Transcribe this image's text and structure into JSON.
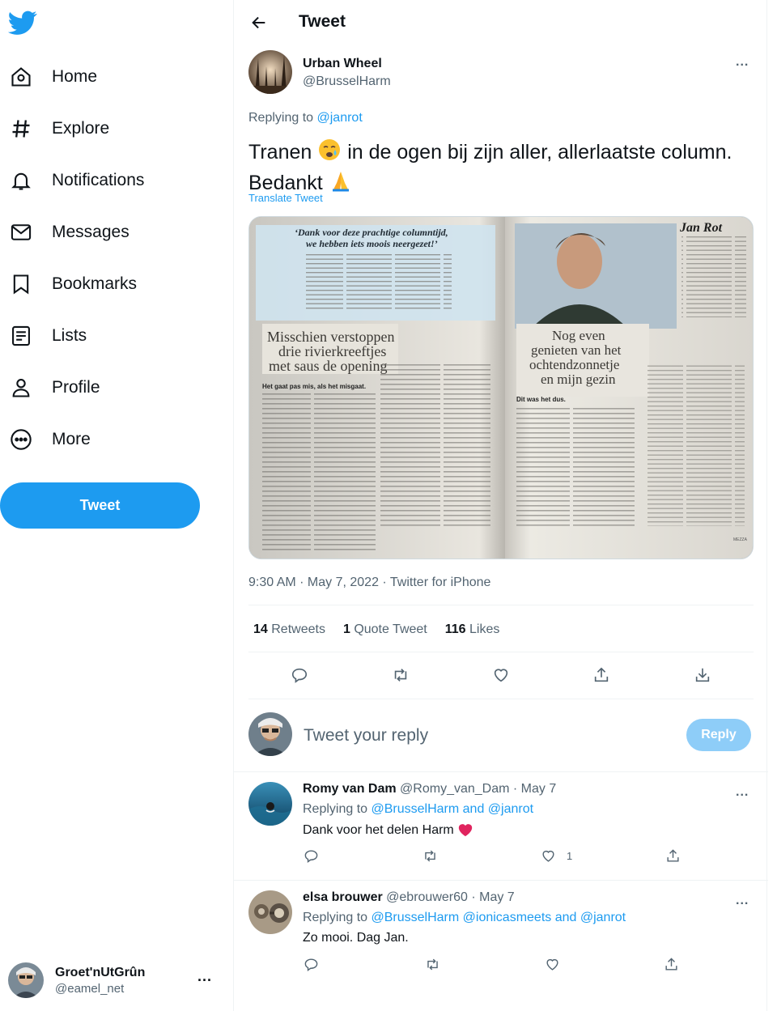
{
  "colors": {
    "brand": "#1d9bf0",
    "reply_disabled": "#8ecdf8",
    "heart": "#f91880",
    "secondary_text": "#536471"
  },
  "sidebar": {
    "logo": "twitter-bird-icon",
    "items": [
      {
        "label": "Home",
        "icon": "home-icon"
      },
      {
        "label": "Explore",
        "icon": "hashtag-icon"
      },
      {
        "label": "Notifications",
        "icon": "bell-icon"
      },
      {
        "label": "Messages",
        "icon": "envelope-icon"
      },
      {
        "label": "Bookmarks",
        "icon": "bookmark-icon"
      },
      {
        "label": "Lists",
        "icon": "list-icon"
      },
      {
        "label": "Profile",
        "icon": "person-icon"
      },
      {
        "label": "More",
        "icon": "more-circle-icon"
      }
    ],
    "tweet_button": "Tweet",
    "account": {
      "name": "Groet'nUtGrûn",
      "handle": "@eamel_net",
      "more": "..."
    }
  },
  "header": {
    "title": "Tweet"
  },
  "tweet": {
    "author_name": "Urban Wheel",
    "author_handle": "@BrusselHarm",
    "more": "...",
    "replying_prefix": "Replying to",
    "replying_to": "@janrot",
    "text_part1": "Tranen",
    "text_part2": "in de ogen bij zijn aller, allerlaatste column. Bedankt",
    "translate": "Translate Tweet",
    "media": {
      "left_quote": "'Dank voor deze prachtige columntijd, we hebben iets moois neergezet!'",
      "left_headline_1": "Misschien verstoppen",
      "left_headline_2": "drie rivierkreeftjes",
      "left_headline_3": "met saus de opening",
      "left_lead": "Het gaat pas mis, als het misgaat.",
      "right_byline": "Jan Rot",
      "right_headline_1": "Nog even",
      "right_headline_2": "genieten van het",
      "right_headline_3": "ochtendzonnetje",
      "right_headline_4": "en mijn gezin",
      "right_lead": "Dit was het dus.",
      "footer": "MEZZA"
    },
    "meta": "9:30 AM · May 7, 2022 · Twitter for iPhone",
    "stats": {
      "retweets_count": "14",
      "retweets_label": "Retweets",
      "quotes_count": "1",
      "quotes_label": "Quote Tweet",
      "likes_count": "116",
      "likes_label": "Likes"
    }
  },
  "reply_box": {
    "placeholder": "Tweet your reply",
    "button": "Reply"
  },
  "replies": [
    {
      "name": "Romy van Dam",
      "handle_date": "@Romy_van_Dam · May 7",
      "replying_prefix": "Replying to",
      "replying_to": "@BrusselHarm and @janrot",
      "text": "Dank voor het delen Harm",
      "likes": "1",
      "more": "..."
    },
    {
      "name": "elsa brouwer",
      "handle_date": "@ebrouwer60 · May 7",
      "replying_prefix": "Replying to",
      "replying_to": "@BrusselHarm @ionicasmeets and @janrot",
      "text": "Zo mooi. Dag Jan.",
      "likes": "",
      "more": "..."
    }
  ]
}
